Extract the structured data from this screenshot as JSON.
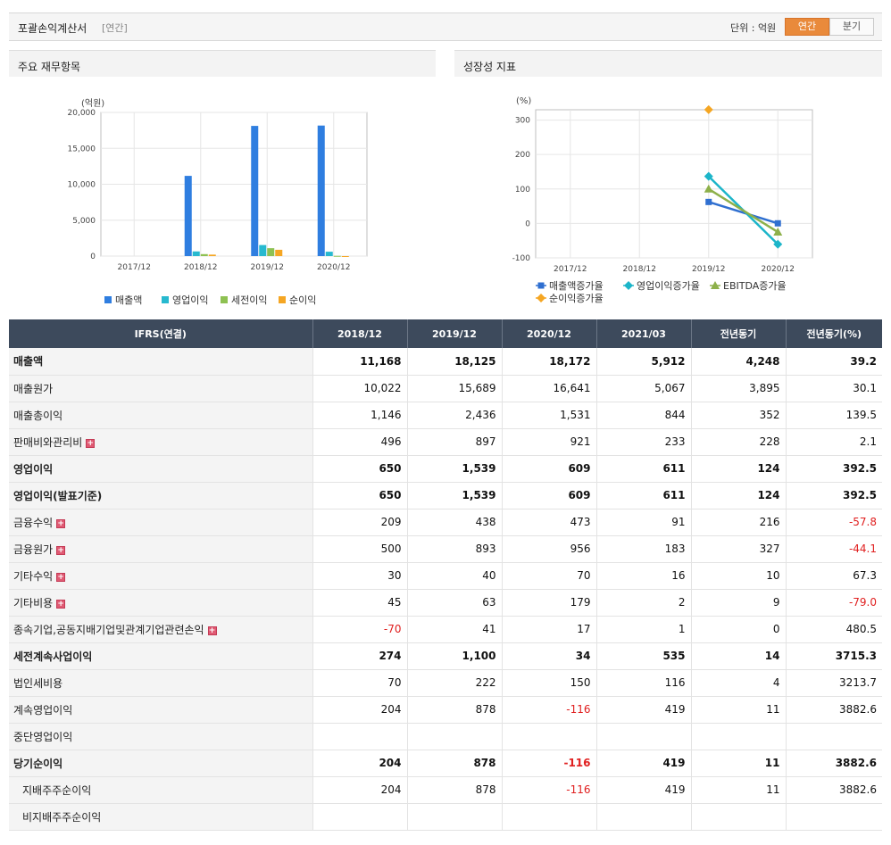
{
  "header": {
    "title": "포괄손익계산서",
    "subtitle": "[연간]",
    "unit_label": "단위 : 억원",
    "tabs": [
      {
        "label": "연간",
        "active": true
      },
      {
        "label": "분기",
        "active": false
      }
    ]
  },
  "panels": {
    "left_title": "주요 재무항목",
    "right_title": "성장성 지표"
  },
  "chart_data": [
    {
      "type": "bar",
      "ylabel": "(억원)",
      "categories": [
        "2017/12",
        "2018/12",
        "2019/12",
        "2020/12"
      ],
      "ylim": [
        0,
        20000
      ],
      "yticks": [
        0,
        5000,
        10000,
        15000,
        20000
      ],
      "ytick_labels": [
        "0",
        "5,000",
        "10,000",
        "15,000",
        "20,000"
      ],
      "grid": true,
      "legend": "bottom",
      "series": [
        {
          "name": "매출액",
          "color": "#2f7ee0",
          "values": [
            null,
            11168,
            18125,
            18172
          ]
        },
        {
          "name": "영업이익",
          "color": "#27b9cf",
          "values": [
            null,
            650,
            1539,
            609
          ]
        },
        {
          "name": "세전이익",
          "color": "#8ec152",
          "values": [
            null,
            274,
            1100,
            34
          ]
        },
        {
          "name": "순이익",
          "color": "#f5a623",
          "values": [
            null,
            204,
            878,
            -116
          ]
        }
      ]
    },
    {
      "type": "line",
      "ylabel": "(%)",
      "categories": [
        "2017/12",
        "2018/12",
        "2019/12",
        "2020/12"
      ],
      "ylim": [
        -100,
        330
      ],
      "yticks": [
        -100,
        0,
        100,
        200,
        300
      ],
      "ytick_labels": [
        "-100",
        "0",
        "100",
        "200",
        "300"
      ],
      "grid": true,
      "legend": "bottom",
      "series": [
        {
          "name": "매출액증가율",
          "color": "#2f6fd0",
          "marker": "square",
          "values": [
            null,
            null,
            62.3,
            0.3
          ]
        },
        {
          "name": "영업이익증가율",
          "color": "#1cb5c9",
          "marker": "diamond",
          "values": [
            null,
            null,
            136.8,
            -60.4
          ]
        },
        {
          "name": "EBITDA증가율",
          "color": "#8db04a",
          "marker": "triangle",
          "values": [
            null,
            null,
            100,
            -25
          ]
        },
        {
          "name": "순이익증가율",
          "color": "#f5a623",
          "marker": "diamond",
          "values": [
            null,
            null,
            330.4,
            null
          ]
        }
      ]
    }
  ],
  "table": {
    "columns": [
      "IFRS(연결)",
      "2018/12",
      "2019/12",
      "2020/12",
      "2021/03",
      "전년동기",
      "전년동기(%)"
    ],
    "rows": [
      {
        "label": "매출액",
        "bold": true,
        "values": [
          "11,168",
          "18,125",
          "18,172",
          "5,912",
          "4,248",
          "39.2"
        ]
      },
      {
        "label": "매출원가",
        "values": [
          "10,022",
          "15,689",
          "16,641",
          "5,067",
          "3,895",
          "30.1"
        ]
      },
      {
        "label": "매출총이익",
        "values": [
          "1,146",
          "2,436",
          "1,531",
          "844",
          "352",
          "139.5"
        ]
      },
      {
        "label": "판매비와관리비",
        "expand": true,
        "values": [
          "496",
          "897",
          "921",
          "233",
          "228",
          "2.1"
        ]
      },
      {
        "label": "영업이익",
        "bold": true,
        "topline": true,
        "values": [
          "650",
          "1,539",
          "609",
          "611",
          "124",
          "392.5"
        ]
      },
      {
        "label": "영업이익(발표기준)",
        "bold": true,
        "values": [
          "650",
          "1,539",
          "609",
          "611",
          "124",
          "392.5"
        ]
      },
      {
        "label": "금융수익",
        "expand": true,
        "values": [
          "209",
          "438",
          "473",
          "91",
          "216",
          "-57.8"
        ]
      },
      {
        "label": "금융원가",
        "expand": true,
        "values": [
          "500",
          "893",
          "956",
          "183",
          "327",
          "-44.1"
        ]
      },
      {
        "label": "기타수익",
        "expand": true,
        "values": [
          "30",
          "40",
          "70",
          "16",
          "10",
          "67.3"
        ]
      },
      {
        "label": "기타비용",
        "expand": true,
        "values": [
          "45",
          "63",
          "179",
          "2",
          "9",
          "-79.0"
        ]
      },
      {
        "label": "종속기업,공동지배기업및관계기업관련손익",
        "expand": true,
        "values": [
          "-70",
          "41",
          "17",
          "1",
          "0",
          "480.5"
        ]
      },
      {
        "label": "세전계속사업이익",
        "bold": true,
        "topline": true,
        "values": [
          "274",
          "1,100",
          "34",
          "535",
          "14",
          "3715.3"
        ]
      },
      {
        "label": "법인세비용",
        "values": [
          "70",
          "222",
          "150",
          "116",
          "4",
          "3213.7"
        ]
      },
      {
        "label": "계속영업이익",
        "values": [
          "204",
          "878",
          "-116",
          "419",
          "11",
          "3882.6"
        ]
      },
      {
        "label": "중단영업이익",
        "values": [
          "",
          "",
          "",
          "",
          "",
          ""
        ]
      },
      {
        "label": "당기순이익",
        "bold": true,
        "values": [
          "204",
          "878",
          "-116",
          "419",
          "11",
          "3882.6"
        ]
      },
      {
        "label": "지배주주순이익",
        "indent": true,
        "values": [
          "204",
          "878",
          "-116",
          "419",
          "11",
          "3882.6"
        ]
      },
      {
        "label": "비지배주주순이익",
        "indent": true,
        "values": [
          "",
          "",
          "",
          "",
          "",
          ""
        ]
      }
    ]
  }
}
